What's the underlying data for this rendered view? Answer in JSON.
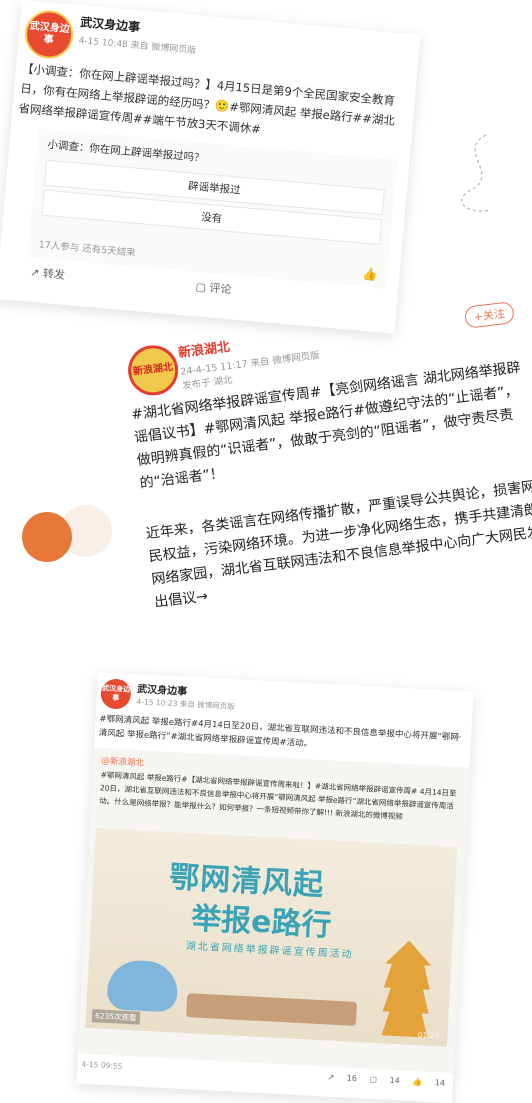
{
  "card1": {
    "avatar_text": "武汉身边事",
    "name": "武汉身边事",
    "meta": "4-15 10:48  来自 微博网页版",
    "text": "【小调查：你在网上辟谣举报过吗？】4月15日是第9个全民国家安全教育日，你有在网络上举报辟谣的经历吗？🙂#鄂网清风起 举报e路行##湖北省网络举报辟谣宣传周##端午节放3天不调休#",
    "poll_title": "小调查：你在网上辟谣举报过吗？",
    "options": [
      "辟谣举报过",
      "没有"
    ],
    "poll_footer": "17人参与  还有5天结束",
    "repost": "转发",
    "comment": "评论"
  },
  "card2": {
    "avatar_text": "新浪湖北",
    "name": "新浪湖北",
    "meta": "24-4-15 11:17  来自 微博网页版",
    "location": "发布于 湖北",
    "follow": "+关注",
    "text": "#湖北省网络举报辟谣宣传周#【亮剑网络谣言 湖北网络举报辟谣倡议书】#鄂网清风起 举报e路行#做遵纪守法的“止谣者”，做明辨真假的“识谣者”，做敢于亮剑的“阻谣者”，做守责尽责的“治谣者”！",
    "text2": "近年来，各类谣言在网络传播扩散，严重误导公共舆论，损害网民权益，污染网络环境。为进一步净化网络生态，携手共建清朗网络家园，湖北省互联网违法和不良信息举报中心向广大网民发出倡议→",
    "banner": "鄂网清风起 举报e路行"
  },
  "card3": {
    "avatar_text": "武汉身边事",
    "name": "武汉身边事",
    "meta": "4-15 10:23  来自 微博网页版",
    "text": "#鄂网清风起 举报e路行#4月14日至20日，湖北省互联网违法和不良信息举报中心将开展“鄂网清风起 举报e路行”#湖北省网络举报辟谣宣传周#活动。",
    "repost_name": "@新浪湖北",
    "repost_text": "#鄂网清风起 举报e路行#【湖北省网络举报辟谣宣传周来啦！】#湖北省网络举报辟谣宣传周# 4月14日至20日，湖北省互联网违法和不良信息举报中心将开展“鄂网清风起 举报e路行”湖北省网络举报辟谣宣传周活动。什么是网络举报？能举报什么？如何举报？一条短视频带你了解!!! 新浪湖北的微博视频",
    "video_title1": "鄂网清风起",
    "video_title2": "举报e路行",
    "video_sub": "湖北省网络举报辟谣宣传周活动",
    "views": "6235次观看",
    "duration": "01:29",
    "date": "4-15 09:55",
    "stats": [
      "16",
      "14",
      "14"
    ]
  },
  "colors": {
    "accent": "#eb7350",
    "dot": "#e8783a",
    "video_title": "#3aa3b6"
  }
}
